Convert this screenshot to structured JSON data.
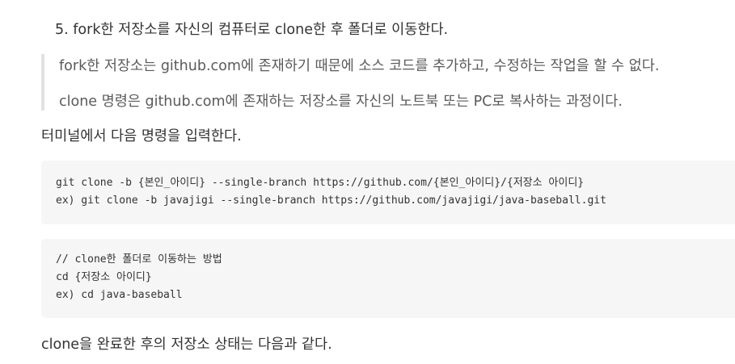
{
  "step": {
    "text": "5. fork한 저장소를 자신의 컴퓨터로 clone한 후 폴더로 이동한다."
  },
  "quote": {
    "lines": [
      "fork한 저장소는 github.com에 존재하기 때문에 소스 코드를 추가하고, 수정하는 작업을 할 수 없다.",
      "clone 명령은 github.com에 존재하는 저장소를 자신의 노트북 또는 PC로 복사하는 과정이다."
    ]
  },
  "paragraphs": [
    "터미널에서 다음 명령을 입력한다.",
    "clone을 완료한 후의 저장소 상태는 다음과 같다."
  ],
  "code_blocks": [
    {
      "lines": [
        "git clone -b {본인_아이디} --single-branch https://github.com/{본인_아이디}/{저장소 아이디}",
        "ex) git clone -b javajigi --single-branch https://github.com/javajigi/java-baseball.git"
      ]
    },
    {
      "lines": [
        "// clone한 폴더로 이동하는 방법",
        "cd {저장소 아이디}",
        "ex) cd java-baseball"
      ]
    }
  ]
}
